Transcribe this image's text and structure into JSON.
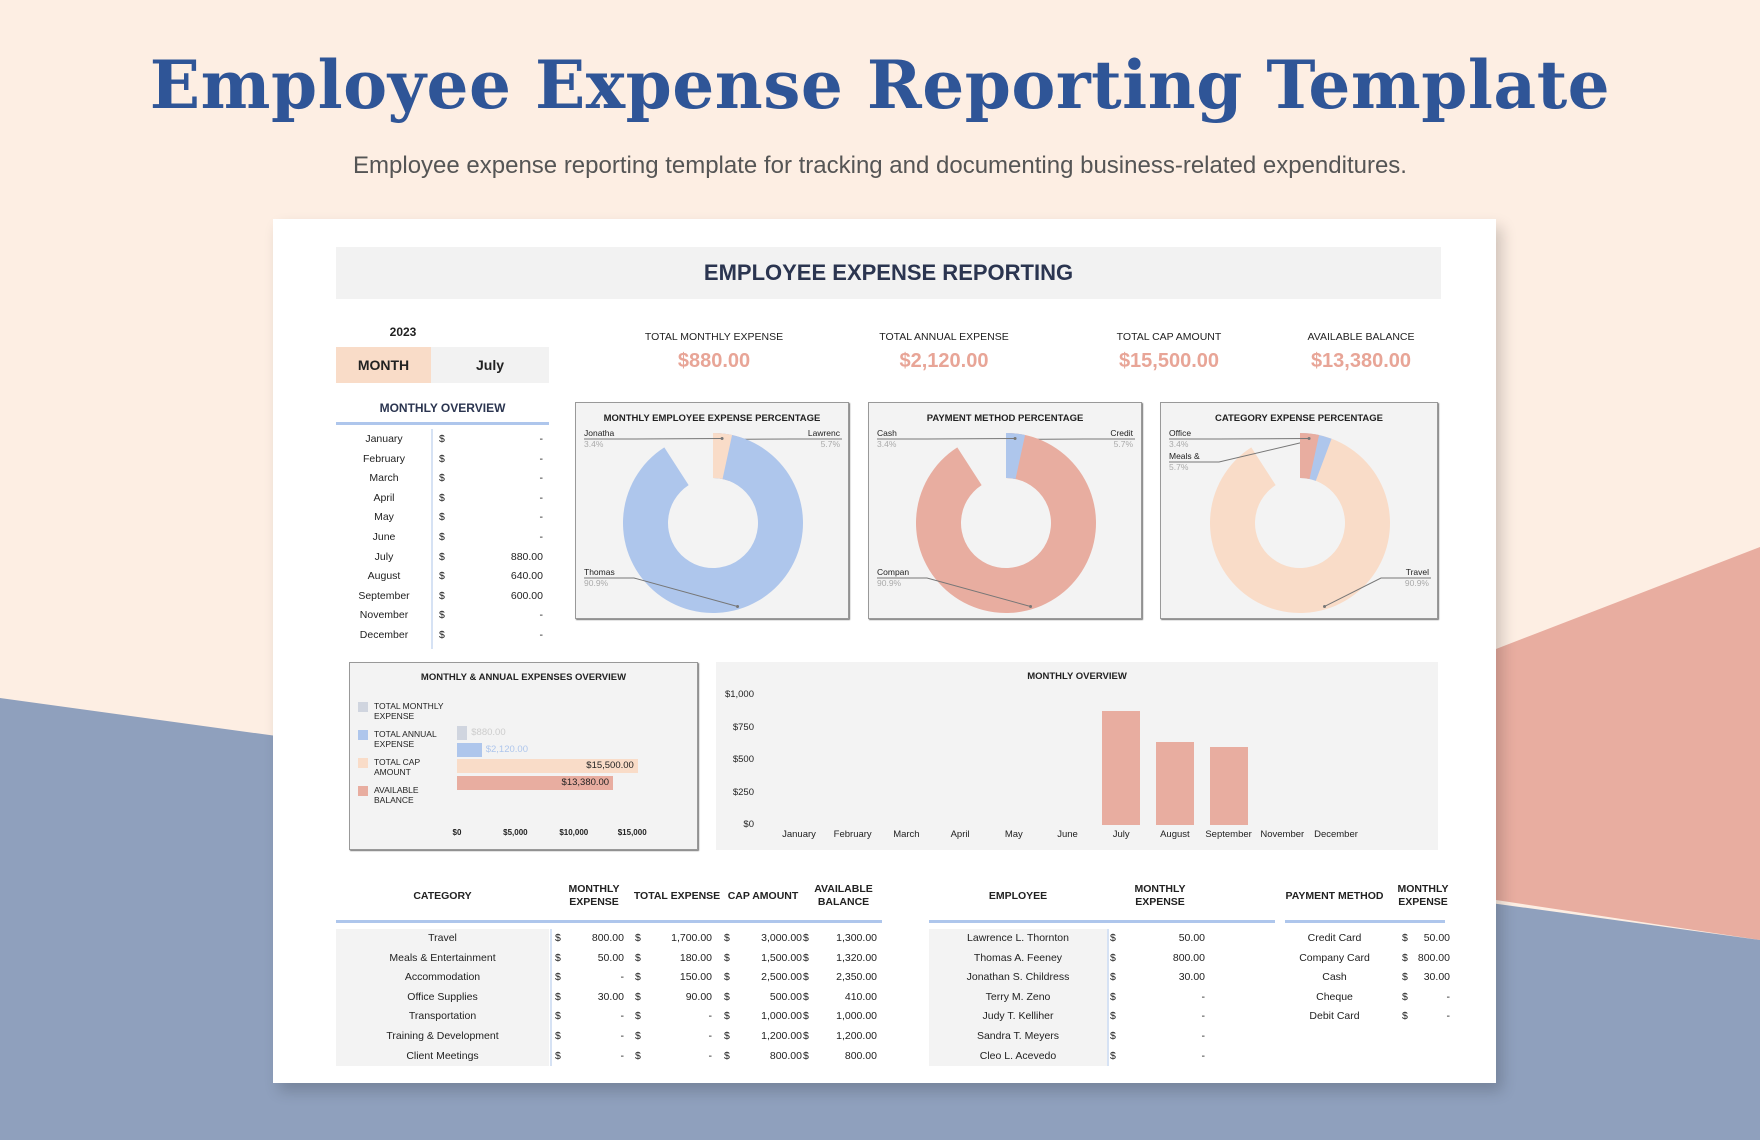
{
  "page": {
    "title": "Employee Expense Reporting Template",
    "subtitle": "Employee expense reporting template for tracking and documenting business-related expenditures."
  },
  "colors": {
    "background": "#fdeee3",
    "title": "#2f5597",
    "blue": "#aec6ec",
    "salmon": "#e8ada0",
    "peach": "#f9dcc8",
    "gray": "#d0d5df",
    "slate": "#8fa0bd"
  },
  "sheet": {
    "header": "EMPLOYEE EXPENSE REPORTING",
    "year": "2023",
    "month_label": "MONTH",
    "month_value": "July",
    "kpis": [
      {
        "label": "TOTAL MONTHLY EXPENSE",
        "value": "$880.00"
      },
      {
        "label": "TOTAL ANNUAL EXPENSE",
        "value": "$2,120.00"
      },
      {
        "label": "TOTAL CAP AMOUNT",
        "value": "$15,500.00"
      },
      {
        "label": "AVAILABLE BALANCE",
        "value": "$13,380.00"
      }
    ],
    "monthly_overview": {
      "title": "MONTHLY OVERVIEW",
      "currency": "$",
      "rows": [
        {
          "month": "January",
          "amount": "-"
        },
        {
          "month": "February",
          "amount": "-"
        },
        {
          "month": "March",
          "amount": "-"
        },
        {
          "month": "April",
          "amount": "-"
        },
        {
          "month": "May",
          "amount": "-"
        },
        {
          "month": "June",
          "amount": "-"
        },
        {
          "month": "July",
          "amount": "880.00"
        },
        {
          "month": "August",
          "amount": "640.00"
        },
        {
          "month": "September",
          "amount": "600.00"
        },
        {
          "month": "November",
          "amount": "-"
        },
        {
          "month": "December",
          "amount": "-"
        }
      ]
    },
    "category_table": {
      "headers": [
        "CATEGORY",
        "MONTHLY EXPENSE",
        "TOTAL EXPENSE",
        "CAP AMOUNT",
        "AVAILABLE BALANCE"
      ],
      "currency": "$",
      "rows": [
        [
          "Travel",
          "800.00",
          "1,700.00",
          "3,000.00",
          "1,300.00"
        ],
        [
          "Meals & Entertainment",
          "50.00",
          "180.00",
          "1,500.00",
          "1,320.00"
        ],
        [
          "Accommodation",
          "-",
          "150.00",
          "2,500.00",
          "2,350.00"
        ],
        [
          "Office Supplies",
          "30.00",
          "90.00",
          "500.00",
          "410.00"
        ],
        [
          "Transportation",
          "-",
          "-",
          "1,000.00",
          "1,000.00"
        ],
        [
          "Training & Development",
          "-",
          "-",
          "1,200.00",
          "1,200.00"
        ],
        [
          "Client Meetings",
          "-",
          "-",
          "800.00",
          "800.00"
        ]
      ]
    },
    "employee_table": {
      "headers": [
        "EMPLOYEE",
        "MONTHLY EXPENSE"
      ],
      "currency": "$",
      "rows": [
        [
          "Lawrence L. Thornton",
          "50.00"
        ],
        [
          "Thomas A. Feeney",
          "800.00"
        ],
        [
          "Jonathan S. Childress",
          "30.00"
        ],
        [
          "Terry M. Zeno",
          "-"
        ],
        [
          "Judy T. Kelliher",
          "-"
        ],
        [
          "Sandra T. Meyers",
          "-"
        ],
        [
          "Cleo L. Acevedo",
          "-"
        ]
      ]
    },
    "payment_table": {
      "headers": [
        "PAYMENT METHOD",
        "MONTHLY EXPENSE"
      ],
      "currency": "$",
      "rows": [
        [
          "Credit Card",
          "50.00"
        ],
        [
          "Company Card",
          "800.00"
        ],
        [
          "Cash",
          "30.00"
        ],
        [
          "Cheque",
          "-"
        ],
        [
          "Debit Card",
          "-"
        ]
      ]
    }
  },
  "chart_data": [
    {
      "type": "pie",
      "style": "donut",
      "title": "MONTHLY EMPLOYEE EXPENSE PERCENTAGE",
      "slices": [
        {
          "label": "Lawrenc",
          "percent_label": "5.7%",
          "value": 5.7,
          "color": "#e8ada0"
        },
        {
          "label": "Thomas",
          "percent_label": "90.9%",
          "value": 90.9,
          "color": "#aec6ec"
        },
        {
          "label": "Jonatha",
          "percent_label": "3.4%",
          "value": 3.4,
          "color": "#f9dcc8"
        }
      ]
    },
    {
      "type": "pie",
      "style": "donut",
      "title": "PAYMENT METHOD PERCENTAGE",
      "slices": [
        {
          "label": "Credit",
          "percent_label": "5.7%",
          "value": 5.7,
          "color": "#f9dcc8"
        },
        {
          "label": "Compan",
          "percent_label": "90.9%",
          "value": 90.9,
          "color": "#e8ada0"
        },
        {
          "label": "Cash",
          "percent_label": "3.4%",
          "value": 3.4,
          "color": "#aec6ec"
        }
      ]
    },
    {
      "type": "pie",
      "style": "donut",
      "title": "CATEGORY EXPENSE PERCENTAGE",
      "slices": [
        {
          "label": "Travel",
          "percent_label": "90.9%",
          "value": 90.9,
          "color": "#f9dcc8"
        },
        {
          "label": "Meals &",
          "percent_label": "5.7%",
          "value": 5.7,
          "color": "#aec6ec"
        },
        {
          "label": "Office",
          "percent_label": "3.4%",
          "value": 3.4,
          "color": "#e8ada0"
        }
      ]
    },
    {
      "type": "bar",
      "orientation": "horizontal",
      "title": "MONTHLY & ANNUAL EXPENSES OVERVIEW",
      "legend": "left",
      "xlim": [
        0,
        15000
      ],
      "xticks": [
        "$0",
        "$5,000",
        "$10,000",
        "$15,000"
      ],
      "series": [
        {
          "name": "TOTAL MONTHLY EXPENSE",
          "value": 880,
          "label": "$880.00",
          "color": "#d0d5df"
        },
        {
          "name": "TOTAL ANNUAL EXPENSE",
          "value": 2120,
          "label": "$2,120.00",
          "color": "#aec6ec"
        },
        {
          "name": "TOTAL CAP AMOUNT",
          "value": 15500,
          "label": "$15,500.00",
          "color": "#f9dcc8"
        },
        {
          "name": "AVAILABLE BALANCE",
          "value": 13380,
          "label": "$13,380.00",
          "color": "#e8ada0"
        }
      ]
    },
    {
      "type": "bar",
      "title": "MONTHLY OVERVIEW",
      "ylim": [
        0,
        1000
      ],
      "yticks": [
        "$0",
        "$250",
        "$500",
        "$750",
        "$1,000"
      ],
      "grid": false,
      "color": "#e8ada0",
      "categories": [
        "January",
        "February",
        "March",
        "April",
        "May",
        "June",
        "July",
        "August",
        "September",
        "November",
        "December"
      ],
      "values": [
        0,
        0,
        0,
        0,
        0,
        0,
        880,
        640,
        600,
        0,
        0
      ]
    }
  ]
}
